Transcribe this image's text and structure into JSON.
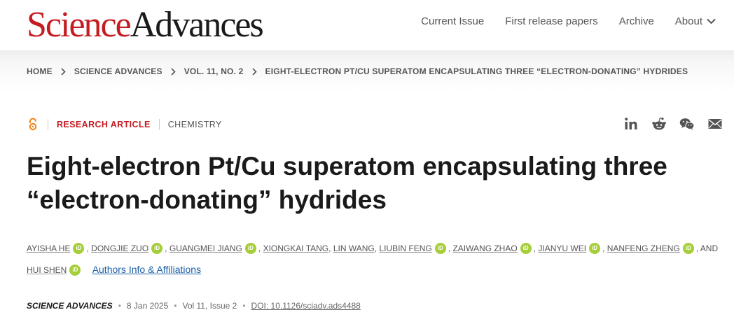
{
  "header": {
    "logo_science": "Science",
    "logo_advances": "Advances",
    "nav": [
      "Current Issue",
      "First release papers",
      "Archive",
      "About"
    ]
  },
  "breadcrumb": [
    "HOME",
    "SCIENCE ADVANCES",
    "VOL. 11, NO. 2",
    "EIGHT-ELECTRON PT/CU SUPERATOM ENCAPSULATING THREE “ELECTRON-DONATING” HYDRIDES"
  ],
  "article": {
    "type": "RESEARCH ARTICLE",
    "subject": "CHEMISTRY",
    "title_line1": "Eight-electron Pt/Cu superatom encapsulating three",
    "title_line2": "“electron-donating” hydrides"
  },
  "share_icons": [
    "linkedin-icon",
    "reddit-icon",
    "wechat-icon",
    "email-icon"
  ],
  "authors": {
    "list": [
      "AYISHA HE",
      "DONGJIE ZUO",
      "GUANGMEI JIANG",
      "XIONGKAI TANG",
      "LIN WANG",
      "LIUBIN FENG",
      "ZAIWANG ZHAO",
      "JIANYU WEI",
      "NANFENG ZHENG",
      "HUI SHEN"
    ],
    "orcid_label": "iD",
    "and": ", AND",
    "comma": ",",
    "affiliations_link": "Authors Info & Affiliations"
  },
  "publication": {
    "journal": "SCIENCE ADVANCES",
    "date": "8 Jan 2025",
    "volume": "Vol 11, Issue 2",
    "doi": "DOI: 10.1126/sciadv.ads4488"
  },
  "colors": {
    "brand_red": "#c41c22",
    "orcid_green": "#a6ce39",
    "link_blue": "#1a5fa8"
  }
}
